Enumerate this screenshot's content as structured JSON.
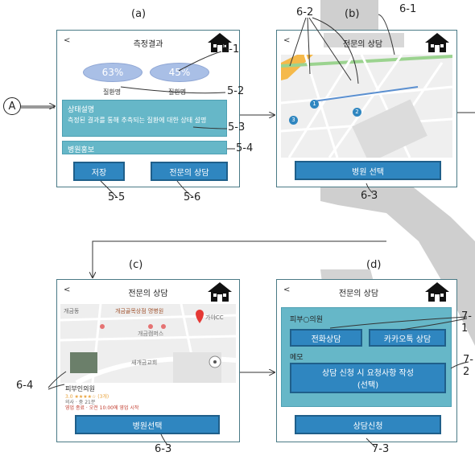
{
  "panels": {
    "a": {
      "label": "(a)",
      "title": "측정결과",
      "back": "<",
      "result1": "63%",
      "result2": "45%",
      "disease1": "질환명",
      "disease2": "질환명",
      "status_title": "상태설명",
      "status_text": "측정된 결과를 통해 추측되는 질환에 대한 상태 설명",
      "hospital_promo": "병원홍보",
      "save_button": "저장",
      "consult_button": "전문의 상담"
    },
    "b": {
      "label": "(b)",
      "title": "전문의 상담",
      "back": "<",
      "pins": [
        "1",
        "2",
        "3"
      ],
      "select_button": "병원 선택"
    },
    "c": {
      "label": "(c)",
      "title": "전문의 상담",
      "back": "<",
      "map_text1": "개금동",
      "map_text2": "개금골목상점 명병원",
      "map_text3": "가야CC",
      "map_text4": "새개금교회",
      "map_text5": "개금캠퍼스",
      "clinic_name": "피부인의원",
      "clinic_rating": "3.0 ★★★★☆ (3개)",
      "clinic_type": "의사 · 중 21분",
      "clinic_hours": "영업 종료 · 오전 10:00에 영업 시작",
      "select_button": "병원선택"
    },
    "d": {
      "label": "(d)",
      "title": "전문의 상담",
      "back": "<",
      "clinic_name": "피부○의원",
      "phone_button": "전화상담",
      "kakao_button": "카카오톡 상담",
      "memo_label": "메모",
      "memo_line1": "상담 신청 시 요청사항 작성",
      "memo_line2": "(선택)",
      "apply_button": "상담신청"
    }
  },
  "callouts": {
    "c51": "5-1",
    "c52": "5-2",
    "c53": "5-3",
    "c54": "5-4",
    "c55": "5-5",
    "c56": "5-6",
    "c62a": "6-2",
    "c61": "6-1",
    "c63a": "6-3",
    "c64": "6-4",
    "c63b": "6-3",
    "c71": "7-1",
    "c72": "7-2",
    "c73": "7-3",
    "a_marker": "A"
  },
  "colors": {
    "accent": "#2f86c0",
    "teal": "#66b7c8",
    "oval": "#a9bfe6",
    "frame": "#4a7a86"
  }
}
